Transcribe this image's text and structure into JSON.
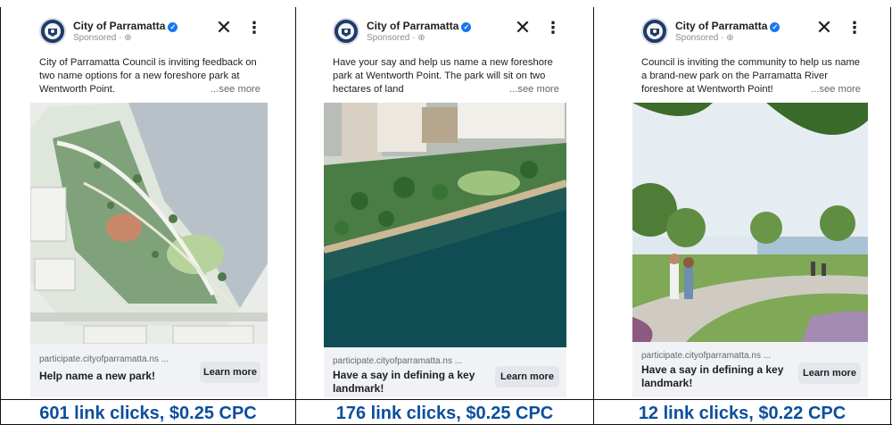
{
  "colors": {
    "brand_blue": "#1877f2",
    "stat_blue": "#0b4f9c",
    "footer_bg": "#f0f2f5",
    "button_bg": "#e4e6eb"
  },
  "ads": [
    {
      "page_name": "City of Parramatta",
      "sponsored": "Sponsored · ",
      "caption": "City of Parramatta Council is inviting feedback on two name options for a new foreshore park at Wentworth Point.",
      "see_more": "...see more",
      "image_icon": "foreshore-plan-image",
      "domain": "participate.cityofparramatta.ns ...",
      "headline": "Help name a new park!",
      "cta": "Learn more",
      "stat": "601 link clicks, $0.25 CPC"
    },
    {
      "page_name": "City of Parramatta",
      "sponsored": "Sponsored · ",
      "caption": "Have your say and help us name a new foreshore park at Wentworth Point. The park will sit on two hectares of land",
      "see_more": "...see more",
      "image_icon": "aerial-park-image",
      "domain": "participate.cityofparramatta.ns ...",
      "headline": "Have a say in defining a key landmark!",
      "cta": "Learn more",
      "stat": "176 link clicks, $0.25 CPC"
    },
    {
      "page_name": "City of Parramatta",
      "sponsored": "Sponsored · ",
      "caption": "Council is inviting the community to help us name a brand-new park on the Parramatta River foreshore at Wentworth Point!",
      "see_more": "...see more",
      "image_icon": "park-walkers-image",
      "domain": "participate.cityofparramatta.ns ...",
      "headline": "Have a say in defining a key landmark!",
      "cta": "Learn more",
      "stat": "12 link clicks, $0.22 CPC"
    }
  ]
}
